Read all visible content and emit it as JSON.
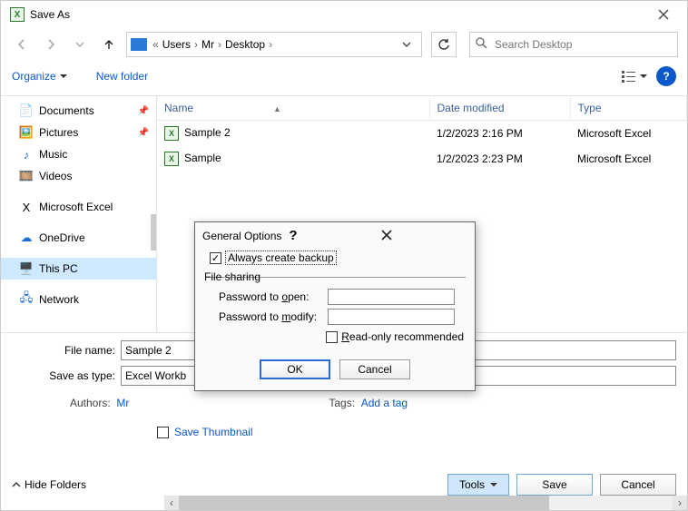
{
  "window": {
    "title": "Save As"
  },
  "nav": {
    "path_prefix": "«",
    "crumbs": [
      "Users",
      "Mr",
      "Desktop"
    ],
    "search_placeholder": "Search Desktop"
  },
  "toolbar": {
    "organize": "Organize",
    "new_folder": "New folder"
  },
  "sidebar": {
    "items": [
      {
        "label": "Documents",
        "pinned": true
      },
      {
        "label": "Pictures",
        "pinned": true
      },
      {
        "label": "Music",
        "pinned": false
      },
      {
        "label": "Videos",
        "pinned": false
      },
      {
        "label": "Microsoft Excel",
        "pinned": false
      },
      {
        "label": "OneDrive",
        "pinned": false
      },
      {
        "label": "This PC",
        "pinned": false
      },
      {
        "label": "Network",
        "pinned": false
      }
    ]
  },
  "columns": {
    "name": "Name",
    "date": "Date modified",
    "type": "Type"
  },
  "files": [
    {
      "name": "Sample 2",
      "date": "1/2/2023 2:16 PM",
      "type": "Microsoft Excel"
    },
    {
      "name": "Sample",
      "date": "1/2/2023 2:23 PM",
      "type": "Microsoft Excel"
    }
  ],
  "form": {
    "filename_label": "File name:",
    "filename_value": "Sample 2",
    "saveastype_label": "Save as type:",
    "saveastype_value": "Excel Workb",
    "authors_label": "Authors:",
    "authors_value": "Mr",
    "tags_label": "Tags:",
    "tags_value": "Add a tag",
    "save_thumb": "Save Thumbnail"
  },
  "footer": {
    "hide_folders": "Hide Folders",
    "tools": "Tools",
    "save": "Save",
    "cancel": "Cancel"
  },
  "modal": {
    "title": "General Options",
    "always_backup": "Always create backup",
    "file_sharing": "File sharing",
    "pw_open": "Password to open:",
    "pw_modify": "Password to modify:",
    "read_only": "Read-only recommended",
    "ok": "OK",
    "cancel": "Cancel"
  }
}
